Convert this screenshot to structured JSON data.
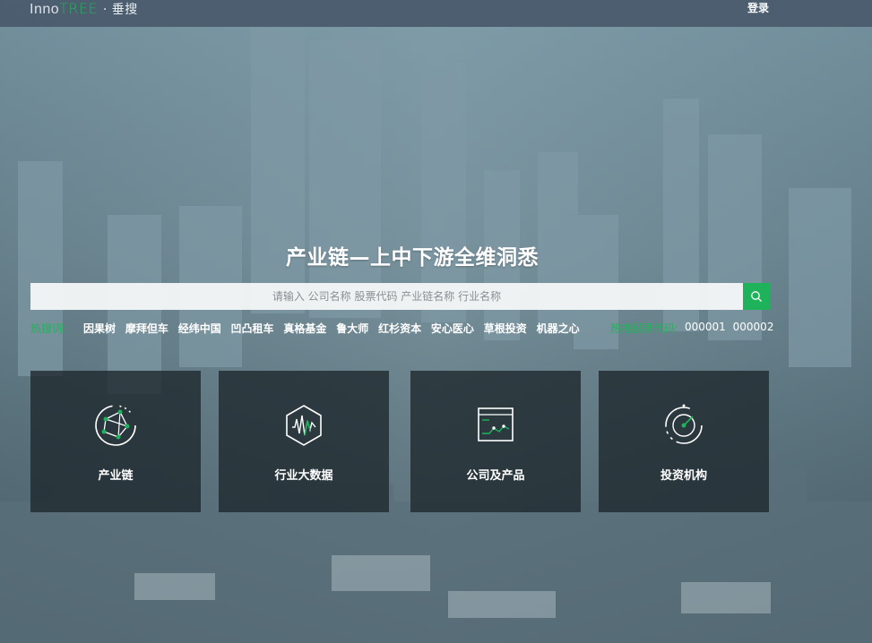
{
  "header": {
    "logo_inno": "Inno",
    "logo_tree": "TREE",
    "logo_cn": "· 垂搜",
    "login_label": "登录"
  },
  "hero": {
    "headline": "产业链—上中下游全维洞悉"
  },
  "search": {
    "placeholder": "请输入 公司名称 股票代码 产业链名称 行业名称",
    "value": "",
    "button_icon": "search-icon"
  },
  "hot": {
    "label": "热搜词:",
    "items": [
      "因果树",
      "摩拜但车",
      "经纬中国",
      "凹凸租车",
      "真格基金",
      "鲁大师",
      "红杉资本",
      "安心医心",
      "草根投资",
      "机器之心"
    ],
    "code_label": "热搜股票代码:",
    "codes": [
      "000001",
      "000002"
    ]
  },
  "cards": [
    {
      "label": "产业链",
      "icon": "industry-chain-icon"
    },
    {
      "label": "行业大数据",
      "icon": "big-data-icon"
    },
    {
      "label": "公司及产品",
      "icon": "company-product-icon"
    },
    {
      "label": "投资机构",
      "icon": "investment-institution-icon"
    }
  ],
  "colors": {
    "accent": "#1eb35b",
    "topbar": "#4b5c6e",
    "card_bg": "#1c262c"
  }
}
